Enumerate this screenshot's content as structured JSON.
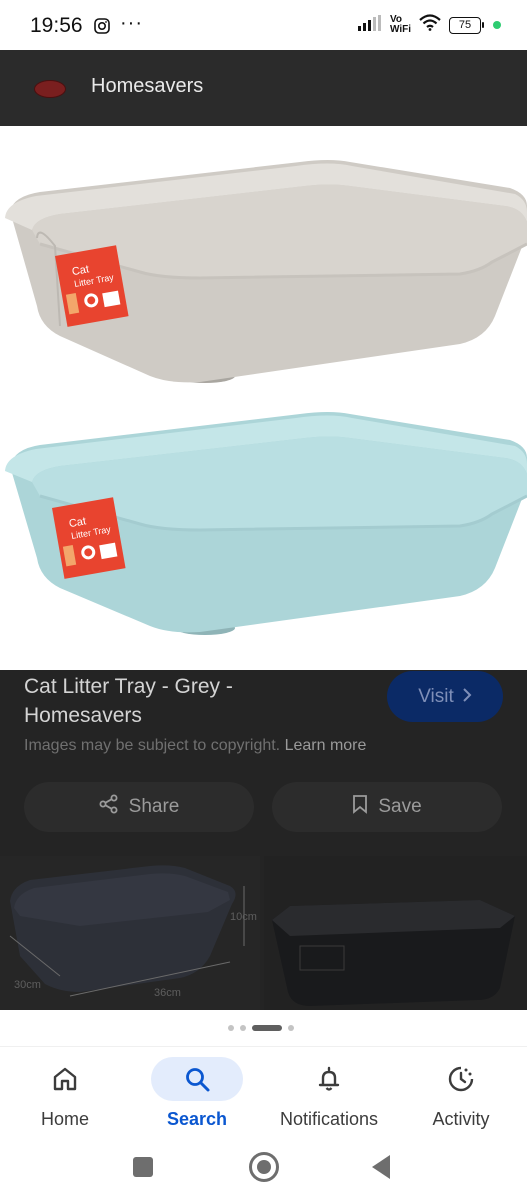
{
  "status_bar": {
    "time": "19:56",
    "more": "···",
    "vowifi_top": "Vo",
    "vowifi_bottom": "WiFi",
    "battery": "75",
    "icons": [
      "instagram-icon",
      "signal-icon",
      "wifi-icon",
      "battery-icon"
    ]
  },
  "header": {
    "site_name": "Homesavers"
  },
  "product": {
    "title": "Cat Litter Tray - Grey - Homesavers",
    "visit_label": "Visit",
    "copyright_text": "Images may be subject to copyright.",
    "learn_more": "Learn more",
    "share_label": "Share",
    "save_label": "Save",
    "tray_colors": {
      "grey": "#d9d5cf",
      "blue": "#b9dfe2"
    },
    "label_text": "Cat Litter Tray"
  },
  "related": {
    "dim_height": "10cm",
    "dim_depth": "30cm",
    "dim_width": "36cm"
  },
  "nav": {
    "items": [
      {
        "label": "Home",
        "icon": "home-icon"
      },
      {
        "label": "Search",
        "icon": "search-icon"
      },
      {
        "label": "Notifications",
        "icon": "bell-icon"
      },
      {
        "label": "Activity",
        "icon": "activity-icon"
      }
    ],
    "active_index": 1,
    "accent": "#0b57d0"
  }
}
